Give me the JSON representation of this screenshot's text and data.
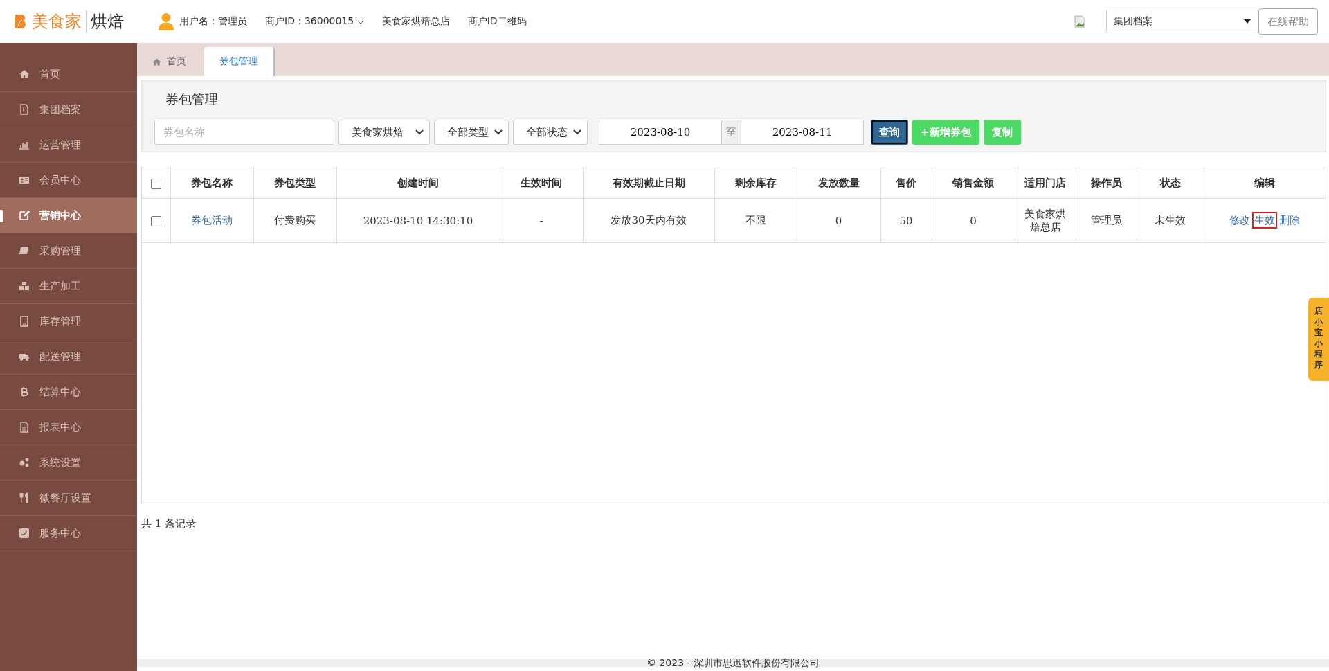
{
  "header": {
    "logo_text": "美食家",
    "logo_suffix": "烘焙",
    "user_label": "用户名：管理员",
    "merchant_id": "商户ID：36000015",
    "store": "美食家烘焙总店",
    "qr_link": "商户ID二维码",
    "archive_select": "集团档案",
    "help_button": "在线帮助"
  },
  "sidebar": {
    "items": [
      {
        "label": "首页",
        "selected": false
      },
      {
        "label": "集团档案",
        "selected": false
      },
      {
        "label": "运营管理",
        "selected": false
      },
      {
        "label": "会员中心",
        "selected": false
      },
      {
        "label": "营销中心",
        "selected": true
      },
      {
        "label": "采购管理",
        "selected": false
      },
      {
        "label": "生产加工",
        "selected": false
      },
      {
        "label": "库存管理",
        "selected": false
      },
      {
        "label": "配送管理",
        "selected": false
      },
      {
        "label": "结算中心",
        "selected": false
      },
      {
        "label": "报表中心",
        "selected": false
      },
      {
        "label": "系统设置",
        "selected": false
      },
      {
        "label": "微餐厅设置",
        "selected": false
      },
      {
        "label": "服务中心",
        "selected": false
      }
    ]
  },
  "tabs": [
    {
      "label": "首页",
      "selected": false
    },
    {
      "label": "券包管理",
      "selected": true
    }
  ],
  "panel": {
    "title": "券包管理",
    "filters": {
      "name_placeholder": "券包名称",
      "store_select": "美食家烘焙",
      "type_select": "全部类型",
      "status_select": "全部状态",
      "date_from": "2023-08-10",
      "date_sep": "至",
      "date_to": "2023-08-11"
    },
    "buttons": [
      {
        "label": "查询",
        "kind": "primary"
      },
      {
        "label": "+新增券包",
        "kind": "success"
      },
      {
        "label": "复制",
        "kind": "success"
      }
    ]
  },
  "table": {
    "all_checked": false,
    "columns": [
      "券包名称",
      "券包类型",
      "创建时间",
      "生效时间",
      "有效期截止日期",
      "剩余库存",
      "发放数量",
      "售价",
      "销售金额",
      "适用门店",
      "操作员",
      "状态",
      "编辑"
    ],
    "rows": [
      {
        "checked": false,
        "cells": [
          "券包活动",
          "付费购买",
          "2023-08-10 14:30:10",
          "-",
          "发放30天内有效",
          "不限",
          "0",
          "50",
          "0",
          "美食家烘焙总店",
          "管理员",
          "未生效"
        ],
        "actions": [
          {
            "label": "修改",
            "highlighted": false
          },
          {
            "label": "生效",
            "highlighted": true
          },
          {
            "label": "删除",
            "highlighted": false
          }
        ]
      }
    ]
  },
  "record_count": "共 1 条记录",
  "side_tab": "店小宝小程序",
  "footer": "© 2023 - 深圳市思迅软件股份有限公司"
}
